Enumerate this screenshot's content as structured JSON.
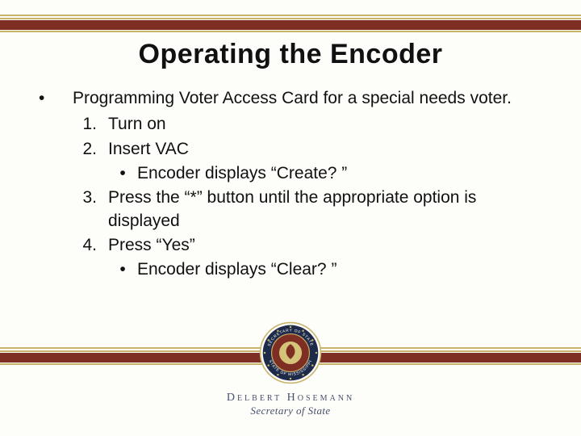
{
  "title": "Operating the Encoder",
  "bullet_char": "•",
  "intro": "Programming Voter Access Card for a special needs voter.",
  "steps": [
    {
      "num": "1.",
      "text": "Turn on"
    },
    {
      "num": "2.",
      "text": "Insert VAC",
      "sub": {
        "bullet": "•",
        "text": "Encoder displays “Create? ”"
      }
    },
    {
      "num": "3.",
      "text": "Press the “*” button until the appropriate option is displayed"
    },
    {
      "num": "4.",
      "text": "Press “Yes”",
      "sub": {
        "bullet": "•",
        "text": "Encoder displays “Clear? ”"
      }
    }
  ],
  "seal": {
    "outer_text_top": "SECRETARY OF STATE",
    "outer_text_bottom": "STATE OF MISSISSIPPI"
  },
  "footer": {
    "name": "Delbert Hosemann",
    "subtitle": "Secretary of State"
  },
  "colors": {
    "gold": "#c8b36a",
    "red": "#7f2e23",
    "navy": "#1e2a4a",
    "slate": "#46506a"
  }
}
